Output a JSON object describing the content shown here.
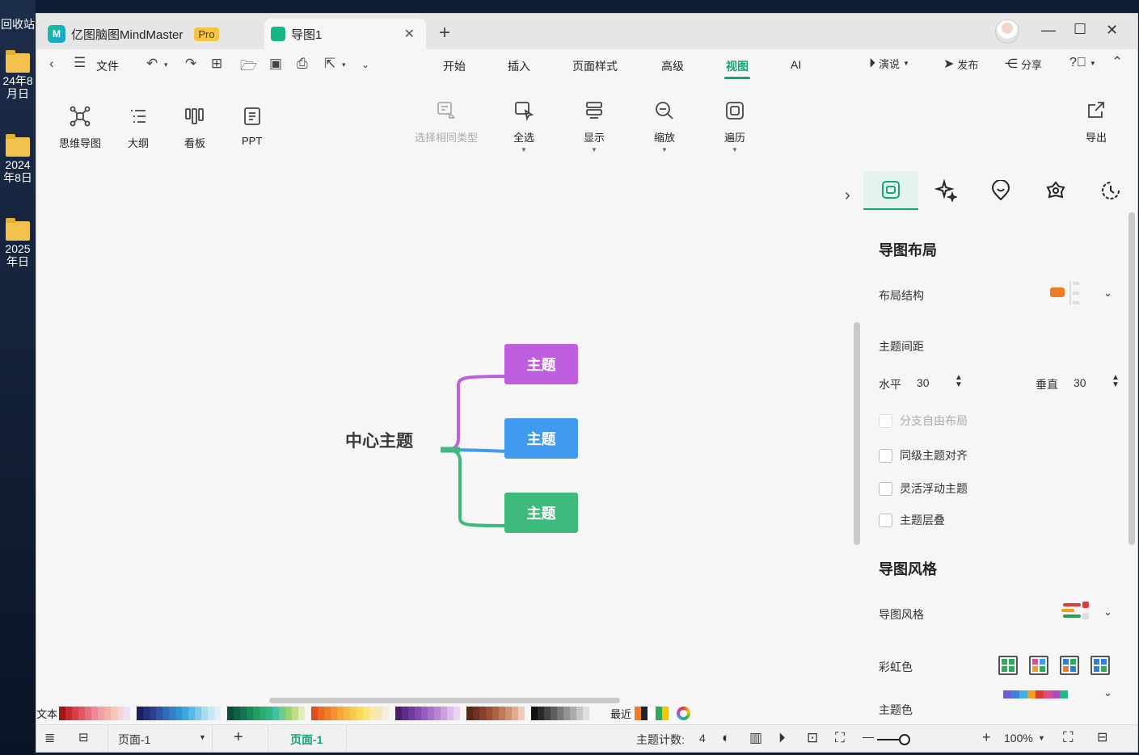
{
  "desktop": {
    "items": [
      {
        "label": "回收站"
      },
      {
        "label": "24年8月日"
      },
      {
        "label": "2024年8日"
      },
      {
        "label": "2025年日"
      }
    ]
  },
  "app": {
    "name": "亿图脑图MindMaster",
    "badge": "Pro",
    "document_tab": "导图1",
    "add_tab": "+"
  },
  "menu": {
    "file": "文件",
    "tabs": [
      "开始",
      "插入",
      "页面样式",
      "高级",
      "视图",
      "AI"
    ],
    "active_tab": "视图",
    "present": "演说",
    "publish": "发布",
    "share": "分享"
  },
  "ribbon": {
    "left": [
      "思维导图",
      "大纲",
      "看板",
      "PPT"
    ],
    "select_same": "选择相同类型",
    "select_all": "全选",
    "display": "显示",
    "zoom": "缩放",
    "traverse": "遍历",
    "export": "导出"
  },
  "mindmap": {
    "center": "中心主题",
    "topics": [
      {
        "label": "主题",
        "color": "#c05ee0"
      },
      {
        "label": "主题",
        "color": "#3f9af0"
      },
      {
        "label": "主题",
        "color": "#3dba7c"
      }
    ]
  },
  "panel": {
    "layout_title": "导图布局",
    "layout_structure": "布局结构",
    "spacing": "主题间距",
    "horizontal_label": "水平",
    "horizontal_value": "30",
    "vertical_label": "垂直",
    "vertical_value": "30",
    "checkboxes": [
      {
        "label": "分支自由布局",
        "checked": false,
        "enabled": false
      },
      {
        "label": "同级主题对齐",
        "checked": false,
        "enabled": true
      },
      {
        "label": "灵活浮动主题",
        "checked": false,
        "enabled": true
      },
      {
        "label": "主题层叠",
        "checked": false,
        "enabled": true
      }
    ],
    "style_title": "导图风格",
    "style_label": "导图风格",
    "rainbow_label": "彩虹色",
    "theme_color_label": "主题色"
  },
  "palette": {
    "text_label": "文本",
    "recent_label": "最近"
  },
  "status": {
    "page_select": "页面-1",
    "page_tab": "页面-1",
    "topic_count_label": "主题计数:",
    "topic_count": "4",
    "zoom": "100%"
  },
  "colors": {
    "accent": "#16a37a"
  }
}
